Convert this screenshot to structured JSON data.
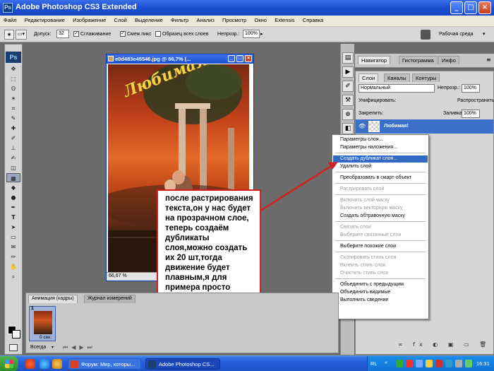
{
  "window": {
    "title": "Adobe Photoshop CS3 Extended",
    "logo": "Ps"
  },
  "menubar": [
    "Файл",
    "Редактирование",
    "Изображение",
    "Слой",
    "Выделение",
    "Фильтр",
    "Анализ",
    "Просмотр",
    "Окно",
    "Extensis",
    "Справка"
  ],
  "options": {
    "tolerance_label": "Допуск:",
    "tolerance_value": "32",
    "antialias_label": "Сглаживание",
    "contiguous_label": "Смеж.пикс",
    "all_layers_label": "Образец всех слоев",
    "opacity_label": "Непрозр.:",
    "opacity_value": "100%",
    "workspace_label": "Рабочая среда"
  },
  "document": {
    "title": "e0d483e45546.jpg @ 66,7% (...",
    "zoom": "66,67 %",
    "image_text": "Любимая!"
  },
  "panels": {
    "top_tabs": [
      "Навигатор",
      "Гистограмма",
      "Инфо"
    ],
    "layer_tabs": [
      "Слои",
      "Каналы",
      "Контуры"
    ],
    "blend_mode": "Нормальный",
    "opacity_label": "Непрозр.:",
    "opacity_value": "100%",
    "unify_label": "Унифицировать:",
    "propagate_label": "Распространить кадр 1",
    "lock_label": "Закрепить:",
    "fill_label": "Заливка:",
    "fill_value": "100%",
    "layer_name": "Любимая!"
  },
  "context_menu": [
    {
      "label": "Параметры слоя...",
      "state": "normal"
    },
    {
      "label": "Параметры наложения...",
      "state": "normal"
    },
    {
      "sep": true
    },
    {
      "label": "Создать дубликат слоя...",
      "state": "highlight"
    },
    {
      "label": "Удалить слой",
      "state": "normal"
    },
    {
      "sep": true
    },
    {
      "label": "Преобразовать в смарт-объект",
      "state": "normal"
    },
    {
      "sep": true
    },
    {
      "label": "Растрировать слой",
      "state": "disabled"
    },
    {
      "sep": true
    },
    {
      "label": "Включить слой-маску",
      "state": "disabled"
    },
    {
      "label": "Включить векторную маску",
      "state": "disabled"
    },
    {
      "label": "Создать обтравочную маску",
      "state": "normal"
    },
    {
      "sep": true
    },
    {
      "label": "Связать слои",
      "state": "disabled"
    },
    {
      "label": "Выберите связанные слои",
      "state": "disabled"
    },
    {
      "sep": true
    },
    {
      "label": "Выберите похожие слои",
      "state": "normal"
    },
    {
      "sep": true
    },
    {
      "label": "Скопировать стиль слоя",
      "state": "disabled"
    },
    {
      "label": "Вклеить стиль слоя",
      "state": "disabled"
    },
    {
      "label": "Очистить стиль слоя",
      "state": "disabled"
    },
    {
      "sep": true
    },
    {
      "label": "Объединить с предыдущим",
      "state": "normal"
    },
    {
      "label": "Объединить видимые",
      "state": "normal"
    },
    {
      "label": "Выполнить сведение",
      "state": "normal"
    }
  ],
  "callout": {
    "text": "после растрирования текста,он у нас будет на прозрачном слое, теперь создаём дубликаты слоя,можно создать их 20 шт,тогда движение будет плавным,я для примера просто сделаю десять слоёв"
  },
  "animation": {
    "tabs": [
      "Анимация (кадры)",
      "Журнал измерений"
    ],
    "frame_number": "1",
    "frame_delay": "0 сек.",
    "loop": "Всегда"
  },
  "taskbar": {
    "items": [
      {
        "label": "Форум: Мир, которы...",
        "icon_color": "#d8402a"
      },
      {
        "label": "Adobe Photoshop CS...",
        "icon_color": "#1a3e6f"
      }
    ],
    "lang": "RL",
    "time": "16:31"
  }
}
